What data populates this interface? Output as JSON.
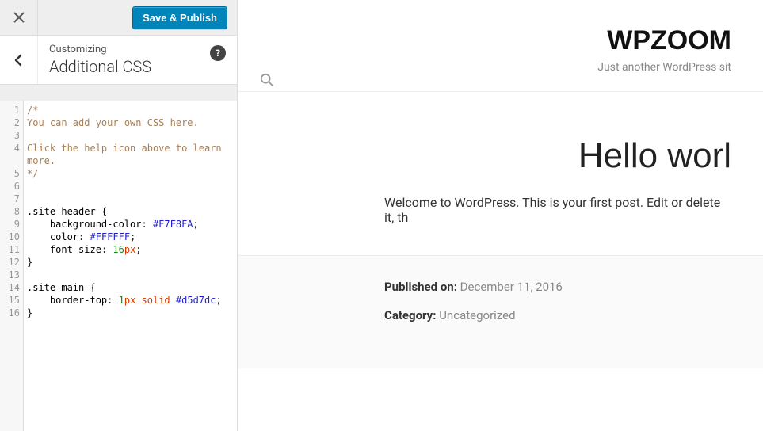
{
  "sidebar": {
    "save_label": "Save & Publish",
    "section_label": "Customizing",
    "section_title": "Additional CSS"
  },
  "code": {
    "lines": 16,
    "l1": "/*",
    "l2": "You can add your own CSS here.",
    "l3": "",
    "l4a": "Click the help icon above to learn ",
    "l4b": "more.",
    "l5": "*/",
    "l8_sel": ".site-header {",
    "l9_prop": "background-color",
    "l9_val": "#F7F8FA",
    "l10_prop": "color",
    "l10_val": "#FFFFFF",
    "l11_prop": "font-size",
    "l11_val_num": "16",
    "l11_val_unit": "px",
    "l12": "}",
    "l14_sel": ".site-main {",
    "l15_prop": "border-top",
    "l15_num": "1",
    "l15_unit": "px",
    "l15_kw": "solid",
    "l15_hex": "#d5d7dc",
    "l16": "}"
  },
  "preview": {
    "site_title": "WPZOOM",
    "tagline": "Just another WordPress sit",
    "post_title": "Hello worl",
    "body": "Welcome to WordPress. This is your first post. Edit or delete it, th",
    "published_label": "Published on:",
    "published_value": "December 11, 2016",
    "category_label": "Category:",
    "category_value": "Uncategorized"
  }
}
